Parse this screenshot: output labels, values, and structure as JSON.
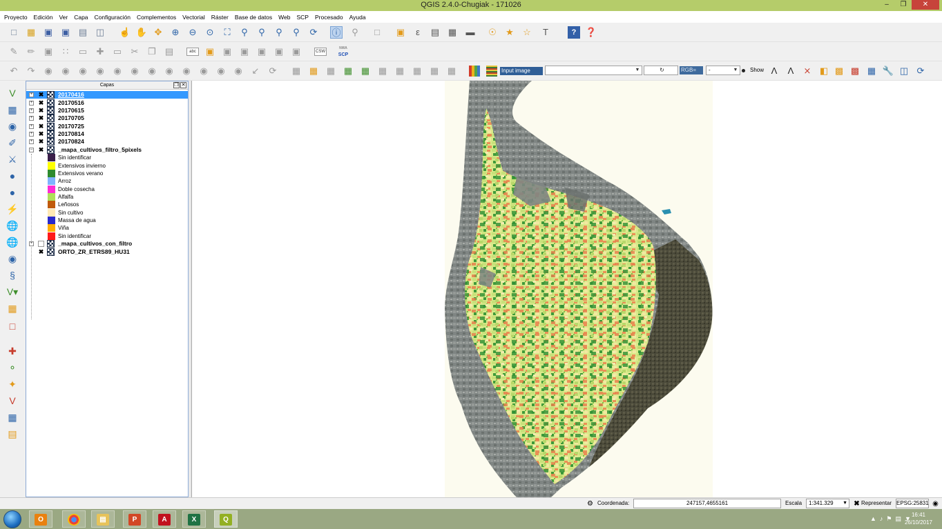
{
  "window": {
    "title": "QGIS 2.4.0-Chugiak - 171026",
    "controls": [
      "minimize-icon",
      "restore-icon",
      "close-icon"
    ]
  },
  "menubar": [
    "Proyecto",
    "Edición",
    "Ver",
    "Capa",
    "Configuración",
    "Complementos",
    "Vectorial",
    "Ráster",
    "Base de datos",
    "Web",
    "SCP",
    "Procesado",
    "Ayuda"
  ],
  "toolbar3": {
    "scp_input_label": "Input image",
    "scp_input_value": "",
    "rgb_label": "RGB=",
    "rgb_value": "-",
    "show_label": "Show"
  },
  "toolbar2": {
    "csw_label": "CSW",
    "scp_label": "SCP",
    "nwa_label": "NWA",
    "abc_label": "abc"
  },
  "layers_panel": {
    "title": "Capas",
    "layers": [
      {
        "name": "20170416",
        "checked": true,
        "selected": true
      },
      {
        "name": "20170516",
        "checked": true
      },
      {
        "name": "20170615",
        "checked": true
      },
      {
        "name": "20170705",
        "checked": true
      },
      {
        "name": "20170725",
        "checked": true
      },
      {
        "name": "20170814",
        "checked": true
      },
      {
        "name": "20170824",
        "checked": true
      },
      {
        "name": "_mapa_cultivos_filtro_5pixels",
        "checked": true,
        "expanded": true
      }
    ],
    "legend": [
      {
        "label": "Sin identificar",
        "color": "#3a1f4a"
      },
      {
        "label": "Extensivos invierno",
        "color": "#ffff00"
      },
      {
        "label": "Extensivos verano",
        "color": "#2e8b2e"
      },
      {
        "label": "Arroz",
        "color": "#7fb3ff"
      },
      {
        "label": "Doble cosecha",
        "color": "#ff2ad4"
      },
      {
        "label": "Alfalfa",
        "color": "#aee05a"
      },
      {
        "label": "Leñosos",
        "color": "#c05a0a"
      },
      {
        "label": "Sin cultivo",
        "color": "#ffe9b5"
      },
      {
        "label": "Massa de agua",
        "color": "#2a2acc"
      },
      {
        "label": "Viña",
        "color": "#ffb000"
      },
      {
        "label": "Sin identificar",
        "color": "#ff1a1a"
      }
    ],
    "layers_after": [
      {
        "name": "_mapa_cultivos_con_filtro",
        "checked": false
      },
      {
        "name": "ORTO_ZR_ETRS89_HU31",
        "checked": true
      }
    ]
  },
  "statusbar": {
    "coord_label": "Coordenada:",
    "coord_value": "247157,4655161",
    "scale_label": "Escala",
    "scale_value": "1:341.329",
    "render_label": "Representar",
    "crs": "EPSG:25831"
  },
  "taskbar": {
    "apps": [
      "Outlook",
      "Chrome",
      "Explorer",
      "PowerPoint",
      "Acrobat",
      "Excel",
      "QGIS"
    ],
    "time": "16:41",
    "date": "26/10/2017"
  }
}
